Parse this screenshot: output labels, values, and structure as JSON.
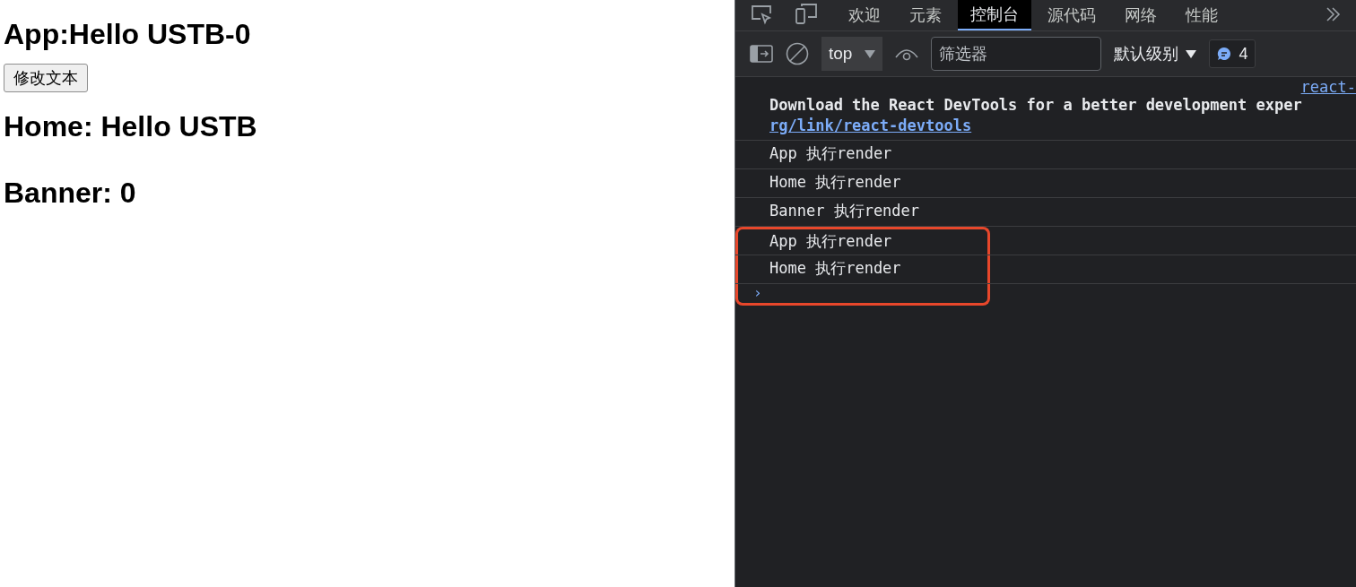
{
  "page": {
    "title": "App:Hello USTB-0",
    "button": "修改文本",
    "home": "Home: Hello USTB",
    "banner": "Banner: 0"
  },
  "devtools": {
    "tabs": [
      {
        "label": "欢迎",
        "selected": false
      },
      {
        "label": "元素",
        "selected": false
      },
      {
        "label": "控制台",
        "selected": true
      },
      {
        "label": "源代码",
        "selected": false
      },
      {
        "label": "网络",
        "selected": false
      },
      {
        "label": "性能",
        "selected": false
      }
    ],
    "toolbar": {
      "context": "top",
      "filter": {
        "placeholder": "筛选器"
      },
      "level": "默认级别",
      "message_count": "4"
    },
    "console": {
      "source_link": "react-",
      "entries": [
        {
          "kind": "notice",
          "text": "Download the React DevTools for a better development exper",
          "link": "rg/link/react-devtools",
          "highlighted": false
        },
        {
          "kind": "log",
          "text": "App 执行render",
          "highlighted": false
        },
        {
          "kind": "log",
          "text": "Home 执行render",
          "highlighted": false
        },
        {
          "kind": "log",
          "text": "Banner 执行render",
          "highlighted": false
        },
        {
          "kind": "log",
          "text": "App 执行render",
          "highlighted": true
        },
        {
          "kind": "log",
          "text": "Home 执行render",
          "highlighted": true
        }
      ],
      "prompt": "›"
    }
  }
}
